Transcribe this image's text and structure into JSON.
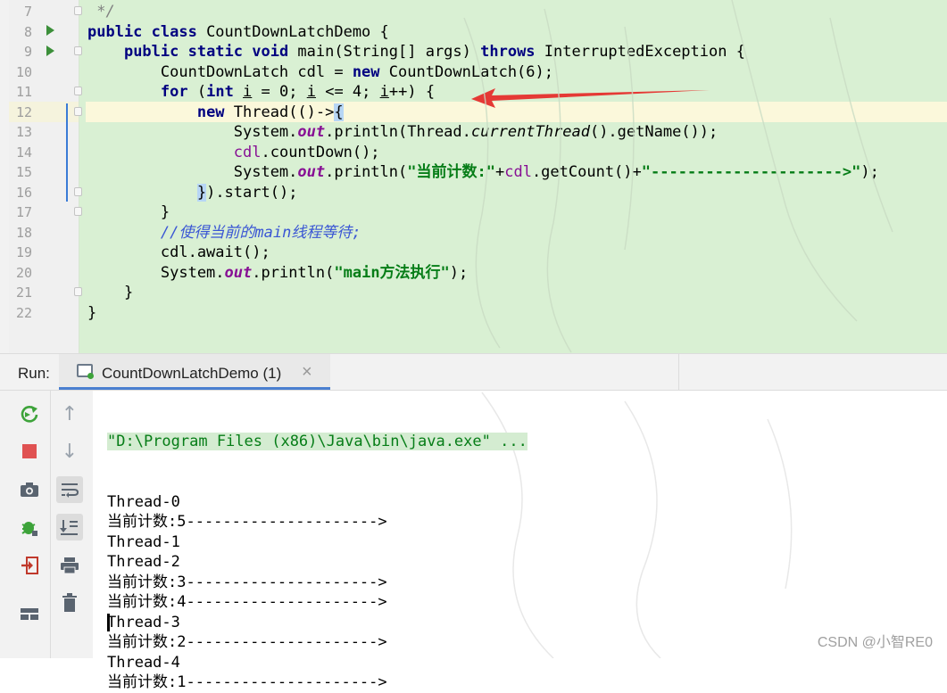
{
  "editor": {
    "line_numbers": [
      "7",
      "8",
      "9",
      "10",
      "11",
      "12",
      "13",
      "14",
      "15",
      "16",
      "17",
      "18",
      "19",
      "20",
      "21",
      "22"
    ],
    "lines": [
      [
        {
          "t": " */",
          "c": "cm"
        }
      ],
      [
        {
          "t": "public class ",
          "c": "kw"
        },
        {
          "t": "CountDownLatchDemo {",
          "c": ""
        }
      ],
      [
        {
          "t": "    "
        },
        {
          "t": "public static void ",
          "c": "kw"
        },
        {
          "t": "main(String[] args) "
        },
        {
          "t": "throws ",
          "c": "kw"
        },
        {
          "t": "InterruptedException {"
        }
      ],
      [
        {
          "t": "        CountDownLatch cdl = "
        },
        {
          "t": "new ",
          "c": "kw"
        },
        {
          "t": "CountDownLatch(6);"
        }
      ],
      [
        {
          "t": "        "
        },
        {
          "t": "for ",
          "c": "kw"
        },
        {
          "t": "("
        },
        {
          "t": "int ",
          "c": "kw"
        },
        {
          "t": "i",
          "c": "uline"
        },
        {
          "t": " = 0; "
        },
        {
          "t": "i",
          "c": "uline"
        },
        {
          "t": " <= 4; "
        },
        {
          "t": "i",
          "c": "uline"
        },
        {
          "t": "++) {"
        }
      ],
      [
        {
          "t": "            "
        },
        {
          "t": "new ",
          "c": "kw"
        },
        {
          "t": "Thread(()->"
        },
        {
          "t": "{",
          "c": "brace-hl"
        }
      ],
      [
        {
          "t": "                System."
        },
        {
          "t": "out",
          "c": "fi"
        },
        {
          "t": ".println(Thread."
        },
        {
          "t": "currentThread",
          "c": "it"
        },
        {
          "t": "().getName());"
        }
      ],
      [
        {
          "t": "                "
        },
        {
          "t": "cdl",
          "c": "vr"
        },
        {
          "t": ".countDown();"
        }
      ],
      [
        {
          "t": "                System."
        },
        {
          "t": "out",
          "c": "fi"
        },
        {
          "t": ".println("
        },
        {
          "t": "\"当前计数:\"",
          "c": "st"
        },
        {
          "t": "+"
        },
        {
          "t": "cdl",
          "c": "vr"
        },
        {
          "t": ".getCount()+"
        },
        {
          "t": "\"--------------------->\"",
          "c": "st"
        },
        {
          "t": ");"
        }
      ],
      [
        {
          "t": "            "
        },
        {
          "t": "}",
          "c": "brace-hl"
        },
        {
          "t": ").start();"
        }
      ],
      [
        {
          "t": "        }"
        }
      ],
      [
        {
          "t": "        "
        },
        {
          "t": "//使得当前的main线程等待;",
          "c": "cmz"
        }
      ],
      [
        {
          "t": "        cdl.await();"
        }
      ],
      [
        {
          "t": "        System."
        },
        {
          "t": "out",
          "c": "fi"
        },
        {
          "t": ".println("
        },
        {
          "t": "\"main方法执行\"",
          "c": "st"
        },
        {
          "t": ");"
        }
      ],
      [
        {
          "t": "    }"
        }
      ],
      [
        {
          "t": "}"
        }
      ]
    ]
  },
  "run_panel": {
    "label": "Run:",
    "tab_label": "CountDownLatchDemo (1)",
    "close_glyph": "×"
  },
  "toolbar_icons": {
    "rerun": "↻",
    "stop": "■",
    "scroll_up": "↑",
    "scroll_down": "↓",
    "camera": "📷",
    "soft_wrap": "⤶",
    "debug": "✱",
    "scroll_end": "⇩",
    "import": "⇥",
    "print": "⎙",
    "layout": "▤",
    "trash": "🗑"
  },
  "console": {
    "command": "\"D:\\Program Files (x86)\\Java\\bin\\java.exe\" ...",
    "output": [
      "Thread-0",
      "当前计数:5--------------------->",
      "Thread-1",
      "Thread-2",
      "当前计数:3--------------------->",
      "当前计数:4--------------------->",
      "Thread-3",
      "当前计数:2--------------------->",
      "Thread-4",
      "当前计数:1--------------------->"
    ]
  },
  "watermark": "CSDN @小智RE0",
  "colors": {
    "editor_bg": "#d9f0d3",
    "keyword": "#000080",
    "string": "#067d17",
    "arrow": "#e53935"
  }
}
